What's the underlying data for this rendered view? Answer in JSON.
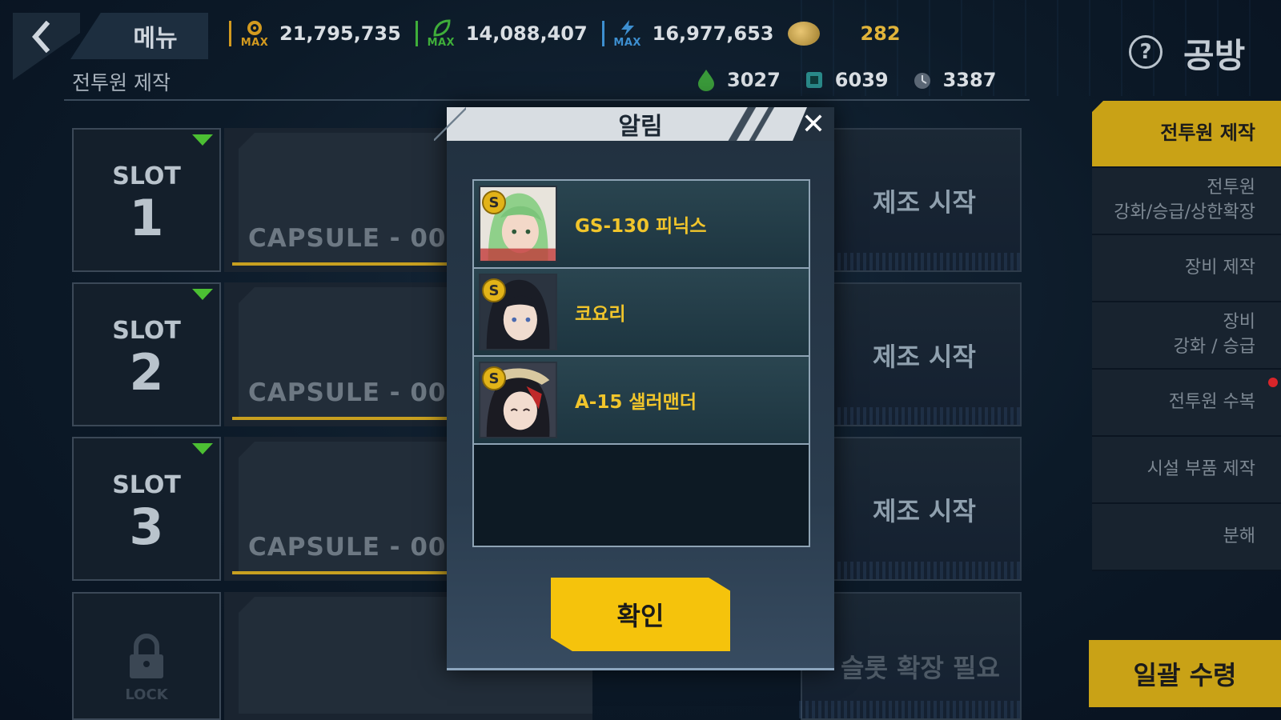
{
  "header": {
    "menu_label": "메뉴",
    "subtitle": "전투원 제작",
    "title": "공방",
    "help_symbol": "?"
  },
  "resources": {
    "row1": [
      {
        "icon": "gear-max-icon",
        "value": "21,795,735",
        "color": "#d39a1f"
      },
      {
        "icon": "leaf-max-icon",
        "value": "14,088,407",
        "color": "#3fae3a"
      },
      {
        "icon": "bolt-max-icon",
        "value": "16,977,653",
        "color": "#3d8fd0"
      },
      {
        "icon": "coin-icon",
        "value": "282",
        "color": "#e1b43a"
      }
    ],
    "row2": [
      {
        "icon": "green-crystal-icon",
        "value": "3027"
      },
      {
        "icon": "chip-icon",
        "value": "6039"
      },
      {
        "icon": "timer-icon",
        "value": "3387"
      }
    ]
  },
  "slots": [
    {
      "word": "SLOT",
      "number": "1",
      "capsule": "CAPSULE - 00",
      "action": "제조 시작"
    },
    {
      "word": "SLOT",
      "number": "2",
      "capsule": "CAPSULE - 00",
      "action": "제조 시작"
    },
    {
      "word": "SLOT",
      "number": "3",
      "capsule": "CAPSULE - 00",
      "action": "제조 시작"
    }
  ],
  "locked_slot": {
    "lock_word": "LOCK",
    "message": "슬롯 확장 필요"
  },
  "side_menu": {
    "items": [
      "전투원 제작",
      "전투원\n강화/승급/상한확장",
      "장비 제작",
      "장비\n강화 / 승급",
      "전투원 수복",
      "시설 부품 제작",
      "분해"
    ],
    "active_index": 0,
    "notification_index": 4
  },
  "bulk_receive_label": "일괄 수령",
  "modal": {
    "title": "알림",
    "close_symbol": "✕",
    "results": [
      {
        "grade": "S",
        "name": "GS-130 피닉스"
      },
      {
        "grade": "S",
        "name": "코요리"
      },
      {
        "grade": "S",
        "name": "A-15 샐러맨더"
      }
    ],
    "confirm_label": "확인"
  },
  "colors": {
    "accent_gold": "#c9a216",
    "confirm_yellow": "#f5c30c",
    "name_gold": "#f1c52b",
    "slot_green": "#4cbf33"
  }
}
